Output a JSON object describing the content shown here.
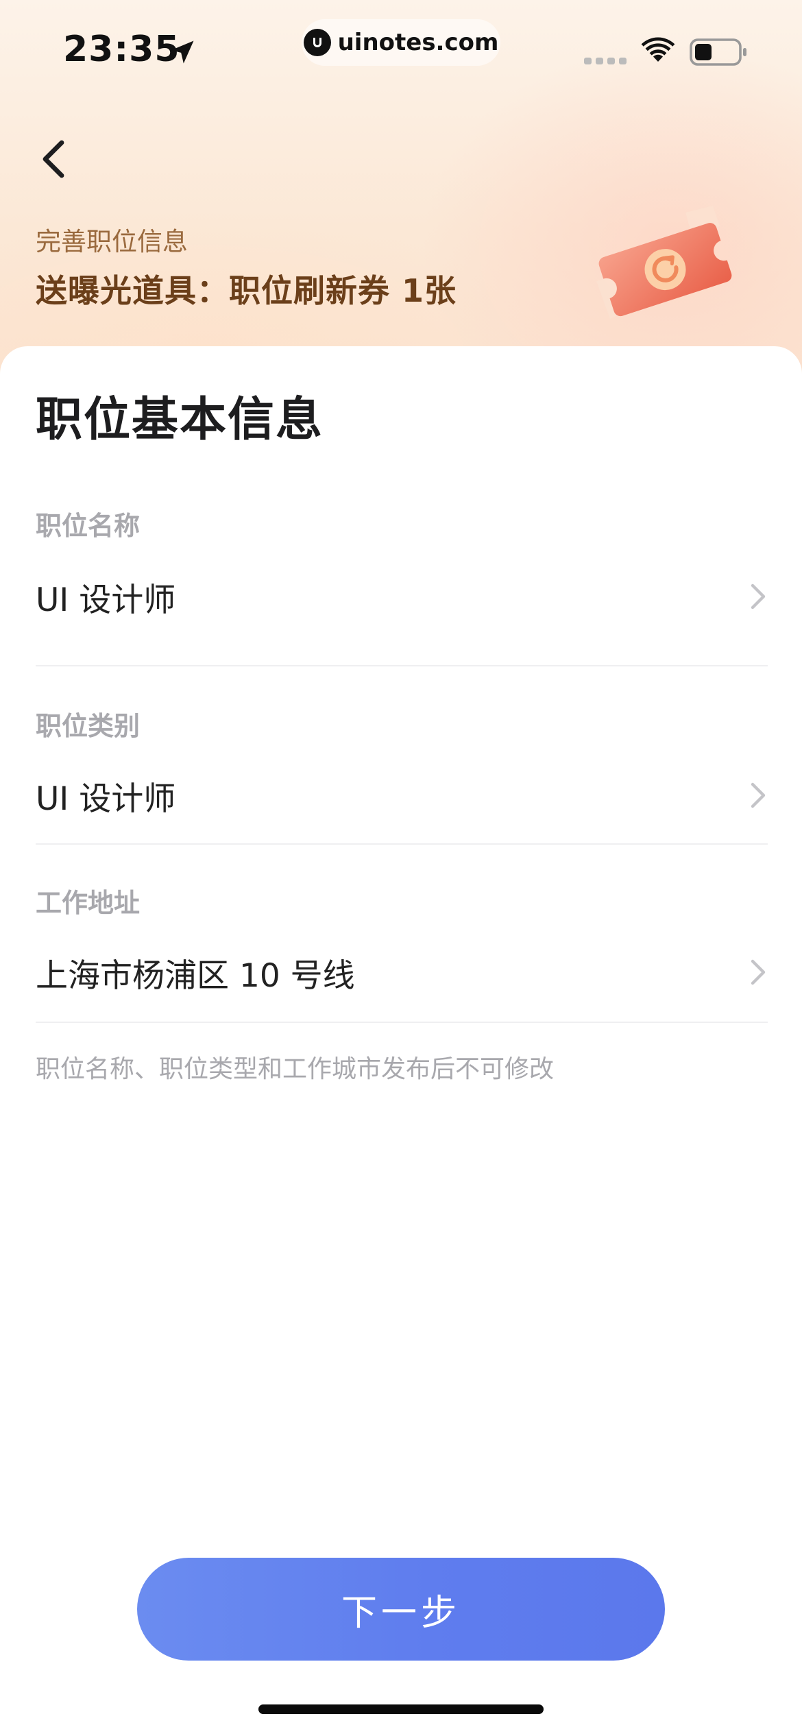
{
  "status_bar": {
    "time": "23:35",
    "url": "uinotes.com"
  },
  "promo": {
    "subtitle": "完善职位信息",
    "title": "送曝光道具：职位刷新券 1张"
  },
  "section": {
    "title": "职位基本信息"
  },
  "fields": [
    {
      "label": "职位名称",
      "value": "UI 设计师"
    },
    {
      "label": "职位类别",
      "value": "UI 设计师"
    },
    {
      "label": "工作地址",
      "value": "上海市杨浦区 10 号线"
    }
  ],
  "hint": "职位名称、职位类型和工作城市发布后不可修改",
  "next_button": {
    "label": "下一步"
  },
  "colors": {
    "accent": "#6180ee",
    "promo_text": "#6b3f1a",
    "label_gray": "#a8a8ad"
  },
  "icons": {
    "back": "chevron-left-icon",
    "row": "chevron-right-icon",
    "ticket": "refresh-ticket-icon"
  }
}
